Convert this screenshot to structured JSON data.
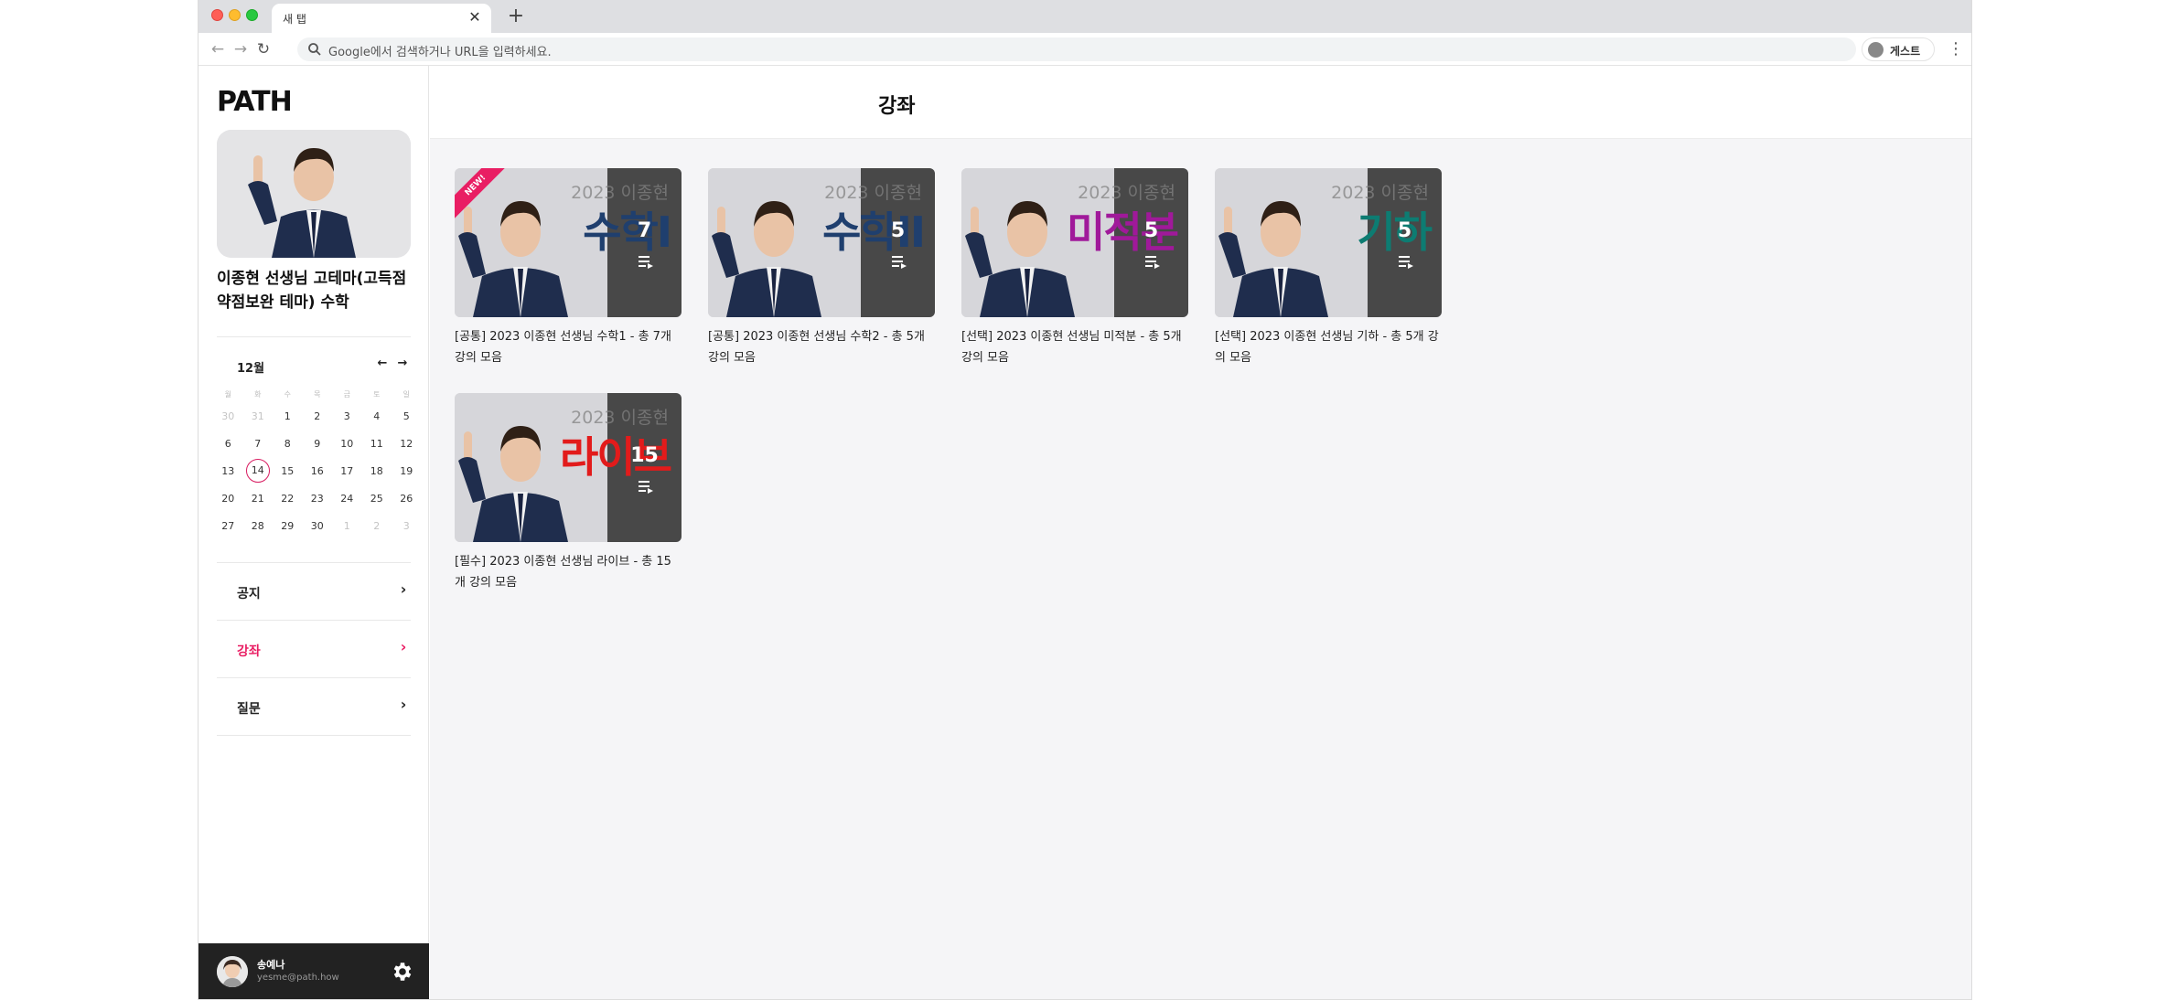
{
  "browser": {
    "tab_title": "새 탭",
    "tab_close": "✕",
    "new_tab": "+",
    "omnibox_placeholder": "Google에서 검색하거나 URL을 입력하세요.",
    "profile_label": "게스트"
  },
  "sidebar": {
    "logo": "PATH",
    "teacher_name": "이종현 선생님 고테마(고득점 약점보완 테마) 수학",
    "calendar": {
      "month": "12월",
      "weekdays": [
        "월",
        "화",
        "수",
        "목",
        "금",
        "토",
        "일"
      ],
      "weeks": [
        [
          "30",
          "31",
          "1",
          "2",
          "3",
          "4",
          "5"
        ],
        [
          "6",
          "7",
          "8",
          "9",
          "10",
          "11",
          "12"
        ],
        [
          "13",
          "14",
          "15",
          "16",
          "17",
          "18",
          "19"
        ],
        [
          "20",
          "21",
          "22",
          "23",
          "24",
          "25",
          "26"
        ],
        [
          "27",
          "28",
          "29",
          "30",
          "1",
          "2",
          "3"
        ]
      ],
      "today": "14"
    },
    "menu": [
      {
        "label": "공지",
        "active": false
      },
      {
        "label": "강좌",
        "active": true
      },
      {
        "label": "질문",
        "active": false
      }
    ],
    "user": {
      "name": "송예나",
      "email": "yesme@path.how"
    }
  },
  "main": {
    "title": "강좌",
    "courses": [
      {
        "year": "2023 이종현",
        "subject": "수학I",
        "subject_color": "#1f3f6e",
        "count": "7",
        "new": true,
        "new_label": "NEW!",
        "caption": "[공통] 2023 이종현 선생님 수학1 - 총 7개 강의 모음"
      },
      {
        "year": "2023 이종현",
        "subject": "수학II",
        "subject_color": "#1f3f6e",
        "count": "5",
        "new": false,
        "caption": "[공통] 2023 이종현 선생님 수학2 - 총 5개 강의 모음"
      },
      {
        "year": "2023 이종현",
        "subject": "미적분",
        "subject_color": "#a0199a",
        "count": "5",
        "new": false,
        "caption": "[선택] 2023 이종현 선생님 미적분 - 총 5개 강의 모음"
      },
      {
        "year": "2023 이종현",
        "subject": "기하",
        "subject_color": "#0d7c72",
        "count": "5",
        "new": false,
        "caption": "[선택] 2023 이종현 선생님 기하 - 총 5개 강의 모음"
      },
      {
        "year": "2023 이종현",
        "subject": "라이브",
        "subject_color": "#e21b1b",
        "count": "15",
        "new": false,
        "caption": "[필수] 2023 이종현 선생님 라이브 - 총 15개 강의 모음"
      }
    ]
  },
  "colors": {
    "accent": "#e91e63",
    "dark_panel": "#222222"
  }
}
